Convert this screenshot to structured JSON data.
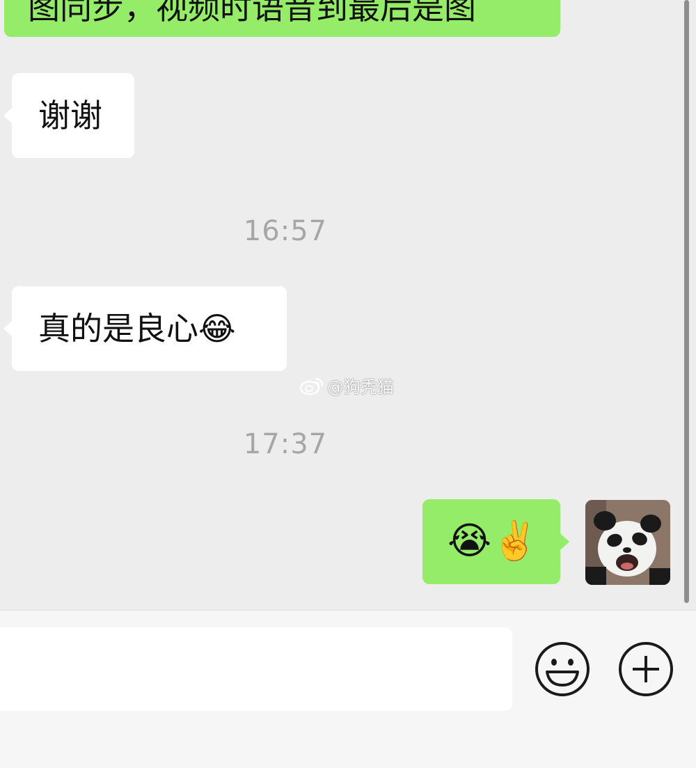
{
  "messages": [
    {
      "sender": "contact",
      "text": "谢谢"
    },
    {
      "sender": "contact",
      "text": "真的是良心😂"
    },
    {
      "sender": "me",
      "text": "😭✌️"
    }
  ],
  "top_partial_message": "图同步，视频时语音到最后是图",
  "timestamps": [
    "16:57",
    "17:37"
  ],
  "watermark": "@狗秃猫",
  "icons": {
    "emoji_button": "smiley-face-icon",
    "more_button": "plus-circle-icon",
    "watermark_logo": "weibo-logo-icon"
  },
  "colors": {
    "background": "#ededed",
    "incoming_bubble": "#ffffff",
    "outgoing_bubble": "#95ec69",
    "timestamp": "#a6a6a6",
    "toolbar": "#f6f6f6"
  },
  "input": {
    "value": ""
  }
}
